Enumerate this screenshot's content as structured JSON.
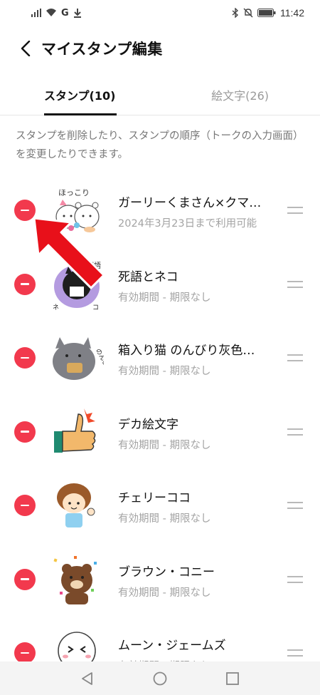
{
  "status_bar": {
    "network_label": "G",
    "time": "11:42"
  },
  "header": {
    "title": "マイスタンプ編集",
    "back_icon": "chevron-left-icon"
  },
  "tabs": [
    {
      "label": "スタンプ(10)",
      "active": true
    },
    {
      "label": "絵文字(26)",
      "active": false
    }
  ],
  "description": "スタンプを削除したり、スタンプの順序（トークの入力画面）を変更したりできます。",
  "stickers": [
    {
      "title": "ガーリーくまさん×クマ…",
      "subtitle": "2024年3月23日まで利用可能",
      "thumb_text": "ほっこり"
    },
    {
      "title": "死語とネコ",
      "subtitle": "有効期間 - 期限なし",
      "thumb_text": "死語"
    },
    {
      "title": "箱入り猫 のんびり灰色…",
      "subtitle": "有効期間 - 期限なし",
      "thumb_text": "のんびり"
    },
    {
      "title": "デカ絵文字",
      "subtitle": "有効期間 - 期限なし",
      "thumb_text": ""
    },
    {
      "title": "チェリーココ",
      "subtitle": "有効期間 - 期限なし",
      "thumb_text": ""
    },
    {
      "title": "ブラウン・コニー",
      "subtitle": "有効期間 - 期限なし",
      "thumb_text": ""
    },
    {
      "title": "ムーン・ジェームズ",
      "subtitle": "有効期間 - 期限なし",
      "thumb_text": ""
    }
  ],
  "colors": {
    "remove_red": "#f2394d",
    "arrow_red": "#e8101a"
  }
}
